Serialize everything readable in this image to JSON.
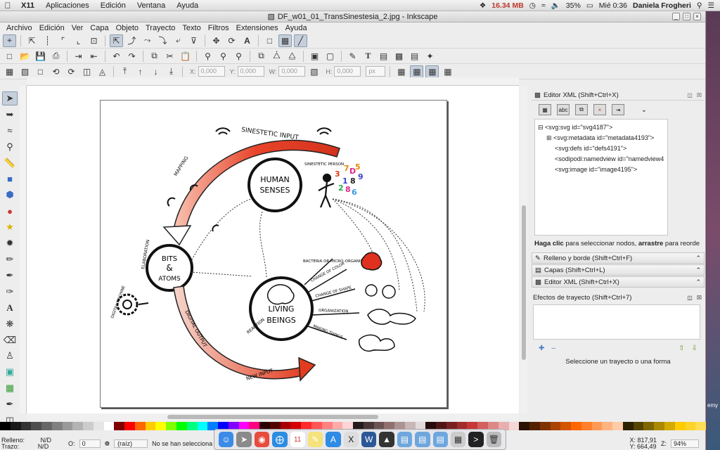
{
  "menubar": {
    "app_name": "X11",
    "items": [
      "Aplicaciones",
      "Edición",
      "Ventana",
      "Ayuda"
    ],
    "memory": "16.34 MB",
    "battery": "35%",
    "clock": "Mié 0:36",
    "user": "Daniela Frogheri"
  },
  "window": {
    "title": "DF_w01_01_TransSinestesia_2.jpg - Inkscape"
  },
  "appmenu": {
    "items": [
      "Archivo",
      "Edición",
      "Ver",
      "Capa",
      "Objeto",
      "Trayecto",
      "Texto",
      "Filtros",
      "Extensiones",
      "Ayuda"
    ]
  },
  "coords": {
    "x_label": "X:",
    "x_value": "0,000",
    "y_label": "Y:",
    "y_value": "0,000",
    "w_label": "W:",
    "w_value": "0,000",
    "h_label": "H:",
    "h_value": "0,000",
    "unit": "px"
  },
  "drawing": {
    "label_sinestetic_input": "SINESTETIC INPUT",
    "label_human_senses_1": "HUMAN",
    "label_human_senses_2": "SENSES",
    "label_bits_1": "BITS",
    "label_bits_2": "&",
    "label_bits_3": "ATOMS",
    "label_living_1": "LIVING",
    "label_living_2": "BEINGS",
    "label_mapping": "MAPPING",
    "label_digital_machine": "DIGITAL MACHINE",
    "label_digital_output": "DIGITAL OUTPUT",
    "label_new_input": "NEW INPUT",
    "label_reaction": "REACTION",
    "label_elaboration": "ELABORATION",
    "label_sinestetic_person": "SINESTETIC PERSON",
    "label_bacteria": "BACTERIA OR MICRO-ORGANISM",
    "label_change_color": "CHANGE OF COLOR",
    "label_change_shape": "CHANGE OF SHAPE",
    "label_organization": "ORGANIZATION",
    "label_making_things": "MAKING THINGS"
  },
  "xml_panel": {
    "title": "Editor XML (Shift+Ctrl+X)",
    "nodes": [
      "<svg:svg id=\"svg4187\">",
      "<svg:metadata id=\"metadata4193\">",
      "<svg:defs id=\"defs4191\">",
      "<sodipodi:namedview id=\"namedview4",
      "<svg:image id=\"image4195\">"
    ],
    "hint_bold_1": "Haga clic",
    "hint_mid": " para seleccionar nodos, ",
    "hint_bold_2": "arrastre",
    "hint_end": " para reorde"
  },
  "dock_panels": [
    "Relleno y borde (Shift+Ctrl+F)",
    "Capas (Shift+Ctrl+L)",
    "Editor XML (Shift+Ctrl+X)"
  ],
  "lpe_panel": {
    "title": "Efectos de trayecto (Shift+Ctrl+7)",
    "status": "Seleccione un trayecto o una forma"
  },
  "statusbar": {
    "fill_label": "Relleno:",
    "fill_value": "N/D",
    "stroke_label": "Trazo:",
    "stroke_value": "N/D",
    "opacity_label": "O:",
    "opacity_value": "0",
    "layer": "(raíz)",
    "message": "No se han selecciona",
    "x_coord": "X: 817,91",
    "y_coord": "Y: 664,49",
    "zoom_label": "Z:",
    "zoom_value": "94%"
  },
  "desktop": {
    "edge_text": "emy"
  }
}
